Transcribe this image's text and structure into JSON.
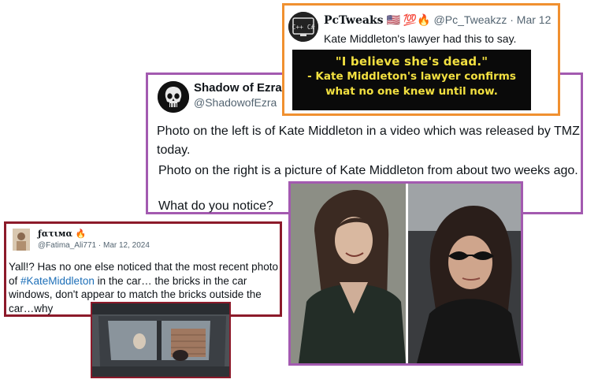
{
  "ezra": {
    "name": "Shadow of Ezra",
    "handle": "@ShadowofEzra",
    "para1": "Photo on the left is of Kate Middleton in a video which was released by TMZ today.",
    "para2": "Photo on the right is a picture of Kate Middleton from about two weeks ago.",
    "para3": "What do you notice?",
    "border_color": "#a35ab0"
  },
  "pctweaks": {
    "name": "PcTweaks",
    "emojis": "🇺🇸 💯🔥",
    "handle": "@Pc_Tweakzz",
    "sep": "·",
    "date": "Mar 12",
    "text": "Kate Middleton's lawyer had this to say.",
    "banner_quote": "\"I believe she's dead.\"",
    "banner_line2": "- Kate Middleton's lawyer confirms",
    "banner_line3": "what no one knew until now.",
    "avatar_text": "C++ C#",
    "border_color": "#f09030"
  },
  "fatima": {
    "name": "ƒατιмα 🔥",
    "handle": "@Fatima_Ali771",
    "sep": "·",
    "date": "Mar 12, 2024",
    "text_before": "Yall!? Has no one else noticed that the most recent photo of ",
    "hashtag": "#KateMiddleton",
    "text_after": " in the car… the bricks in the car windows, don't appear to match the bricks outside the car…why",
    "border_color": "#8c1a2a"
  },
  "icons": [
    "punisher-skull-avatar",
    "pctweaks-logo-avatar",
    "fatima-avatar"
  ]
}
